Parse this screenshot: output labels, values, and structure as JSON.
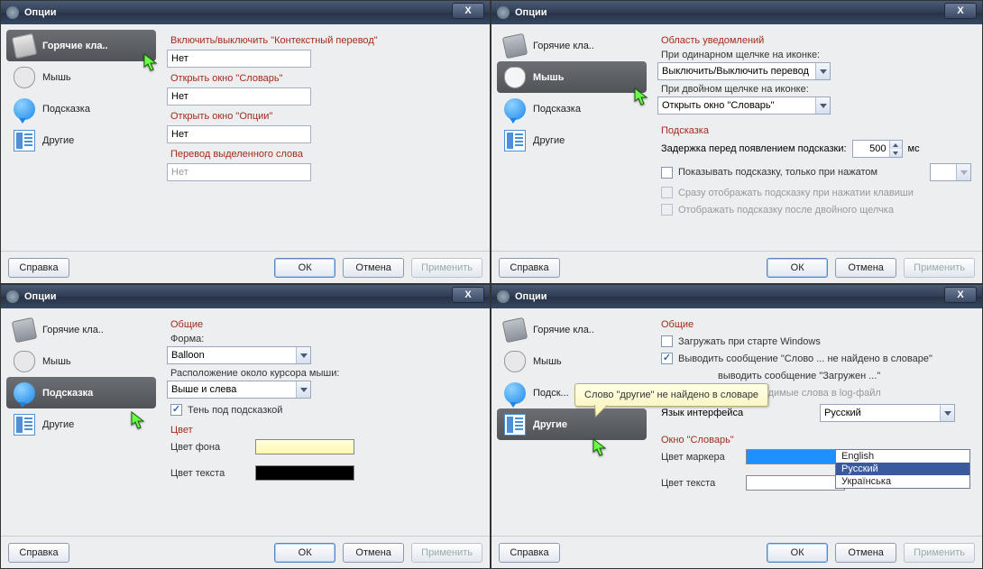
{
  "common": {
    "window_title": "Опции",
    "sidebar": {
      "hotkeys": "Горячие кла..",
      "mouse": "Мышь",
      "tooltip": "Подсказка",
      "other": "Другие"
    },
    "buttons": {
      "help": "Справка",
      "ok": "ОК",
      "cancel": "Отмена",
      "apply": "Применить"
    }
  },
  "w1": {
    "s1": "Включить/выключить \"Контекстный перевод\"",
    "v1": "Нет",
    "s2": "Открыть окно \"Словарь\"",
    "v2": "Нет",
    "s3": "Открыть окно \"Опции\"",
    "v3": "Нет",
    "s4": "Перевод выделенного слова",
    "v4": "Нет"
  },
  "w2": {
    "h1": "Область уведомлений",
    "l1": "При одинарном щелчке на иконке:",
    "c1": "Выключить/Выключить перевод",
    "l2": "При двойном щелчке на иконке:",
    "c2": "Открыть окно \"Словарь\"",
    "h2": "Подсказка",
    "l3": "Задержка перед появлением подсказки:",
    "delay": "500",
    "ms": "мс",
    "chk1": "Показывать подсказку, только при нажатом",
    "chk2": "Сразу отображать подсказку при нажатии клавиши",
    "chk3": "Отображать подсказку после двойного щелчка"
  },
  "w3": {
    "h1": "Общие",
    "l1": "Форма:",
    "c1": "Balloon",
    "l2": "Расположение около курсора мыши:",
    "c2": "Выше и слева",
    "chk1": "Тень под подсказкой",
    "h2": "Цвет",
    "l3": "Цвет фона",
    "l4": "Цвет текста"
  },
  "w4": {
    "h1": "Общие",
    "chk1": "Загружать при старте Windows",
    "chk2": "Выводить сообщение \"Слово ... не найдено в словаре\"",
    "chk3_a": "выводить сообщение \"Загружен ...\"",
    "chk4": "Записывать переводимые слова в log-файл",
    "l1": "Язык интерфейса",
    "lang_val": "Русский",
    "lang_opts": [
      "English",
      "Русский",
      "Українська"
    ],
    "h2": "Окно \"Словарь\"",
    "l2": "Цвет маркера",
    "l3": "Цвет текста",
    "tooltip_text": "Слово \"другие\" не найдено в словаре",
    "other_trunc": "Подск...",
    "other_full": "Другие"
  }
}
